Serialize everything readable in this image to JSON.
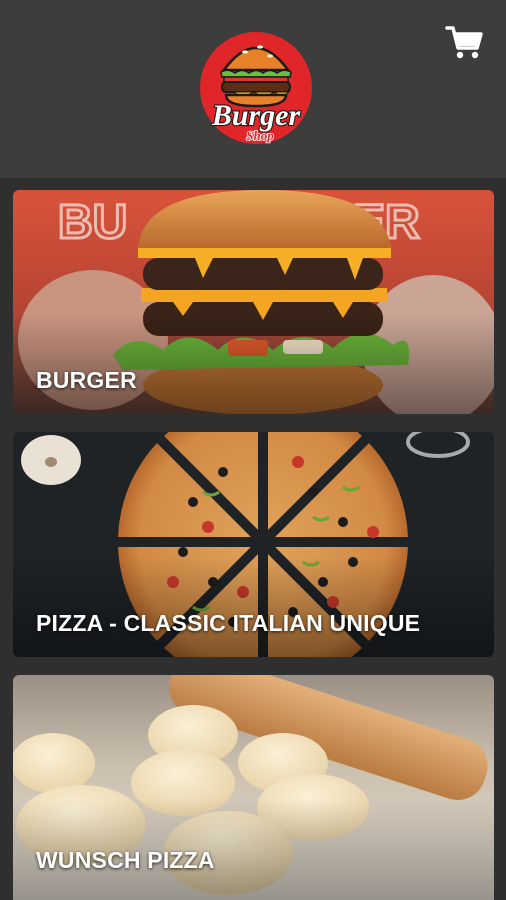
{
  "header": {
    "logo": {
      "title": "Burger",
      "subtitle": "Shop"
    },
    "cart_icon": "shopping-cart-icon"
  },
  "categories": [
    {
      "label": "BURGER"
    },
    {
      "label": "PIZZA - CLASSIC ITALIAN UNIQUE"
    },
    {
      "label": "WUNSCH PIZZA"
    }
  ],
  "colors": {
    "page_bg": "#2f2f2f",
    "header_bg": "#3d3d3d",
    "logo_red": "#e1262a",
    "label_text": "#ffffff"
  }
}
